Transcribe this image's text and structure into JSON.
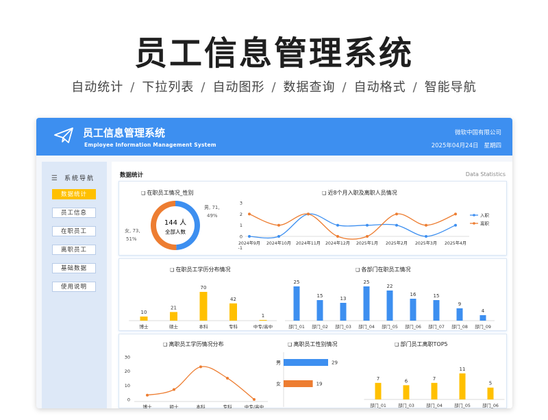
{
  "hero": {
    "title": "员工信息管理系统",
    "features": [
      "自动统计",
      "下拉列表",
      "自动图形",
      "数据查询",
      "自动格式",
      "智能导航"
    ],
    "separator": "/"
  },
  "header": {
    "title": "员工信息管理系统",
    "subtitle": "Employee Information Management System",
    "company": "微软中国有限公司",
    "date": "2025年04月24日",
    "weekday": "星期四",
    "accent": "#3d8ff0"
  },
  "sidebar": {
    "heading": "系统导航",
    "items": [
      {
        "label": "数据统计",
        "active": true
      },
      {
        "label": "员工信息",
        "active": false
      },
      {
        "label": "在职员工",
        "active": false
      },
      {
        "label": "离职员工",
        "active": false
      },
      {
        "label": "基础数据",
        "active": false
      },
      {
        "label": "使用说明",
        "active": false
      }
    ]
  },
  "main": {
    "title": "数据统计",
    "right_label": "Data Statistics"
  },
  "colors": {
    "blue": "#3d8ff0",
    "orange": "#ed7d31",
    "gold": "#ffc000"
  },
  "chart_data": [
    {
      "type": "pie",
      "title": "在职员工情况_性别",
      "center_value": "144 人",
      "center_label": "全部人数",
      "slices": [
        {
          "label": "男",
          "value": 71,
          "percent": "49%",
          "text": "男, 71, 49%"
        },
        {
          "label": "女",
          "value": 73,
          "percent": "51%",
          "text": "女, 73, 51%"
        }
      ]
    },
    {
      "type": "line",
      "title": "近8个月入职及离职人员情况",
      "categories": [
        "2024年9月",
        "2024年10月",
        "2024年11月",
        "2024年12月",
        "2025年1月",
        "2025年2月",
        "2025年3月",
        "2025年4月"
      ],
      "series": [
        {
          "name": "入职",
          "values": [
            0,
            0,
            2,
            1,
            1,
            1,
            0,
            1
          ]
        },
        {
          "name": "离职",
          "values": [
            2,
            1,
            2,
            0,
            0,
            2,
            1,
            2
          ]
        }
      ],
      "yticks": [
        -1,
        0,
        1,
        2,
        3
      ],
      "ylim": [
        -1,
        3
      ],
      "legend": "right"
    },
    {
      "type": "bar",
      "title": "在职员工学历分布情况",
      "categories": [
        "博士",
        "硕士",
        "本科",
        "专科",
        "中专/高中"
      ],
      "values": [
        10,
        21,
        70,
        42,
        1
      ]
    },
    {
      "type": "bar",
      "title": "各部门在职员工情况",
      "categories": [
        "部门_01",
        "部门_02",
        "部门_03",
        "部门_04",
        "部门_05",
        "部门_06",
        "部门_07",
        "部门_08",
        "部门_09"
      ],
      "values": [
        25,
        15,
        13,
        25,
        22,
        16,
        15,
        9,
        4
      ]
    },
    {
      "type": "line",
      "title": "离职员工学历情况分布",
      "categories": [
        "博士",
        "硕士",
        "本科",
        "专科",
        "中专/高中"
      ],
      "values": [
        3,
        7,
        23,
        15,
        0
      ],
      "yticks": [
        0,
        10,
        20,
        30
      ],
      "ylim": [
        0,
        30
      ]
    },
    {
      "type": "bar",
      "title": "离职员工性别情况",
      "orientation": "horizontal",
      "categories": [
        "男",
        "女"
      ],
      "values": [
        29,
        19
      ]
    },
    {
      "type": "bar",
      "title": "部门员工离职TOP5",
      "categories": [
        "部门_01",
        "部门_03",
        "部门_04",
        "部门_05",
        "部门_06"
      ],
      "values": [
        7,
        6,
        7,
        11,
        5
      ]
    }
  ]
}
